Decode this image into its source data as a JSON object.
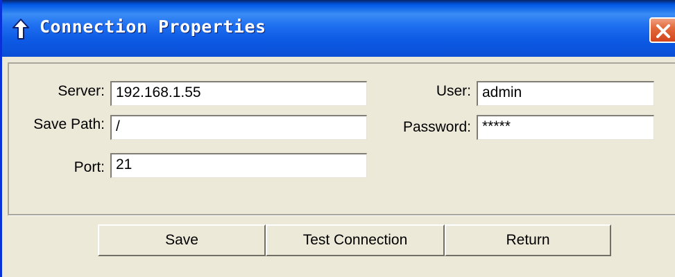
{
  "window": {
    "title": "Connection Properties"
  },
  "form": {
    "server_label": "Server:",
    "server_value": "192.168.1.55",
    "save_path_label": "Save Path:",
    "save_path_value": "/",
    "port_label": "Port:",
    "port_value": "21",
    "user_label": "User:",
    "user_value": "admin",
    "password_label": "Password:",
    "password_value": "*****"
  },
  "buttons": {
    "save": "Save",
    "test_connection": "Test Connection",
    "return": "Return"
  },
  "icons": {
    "title_icon": "up-arrow-icon",
    "close_icon": "close-icon"
  },
  "colors": {
    "titlebar": "#0a5ae4",
    "close_button": "#d2451e",
    "background": "#ece9d8"
  }
}
